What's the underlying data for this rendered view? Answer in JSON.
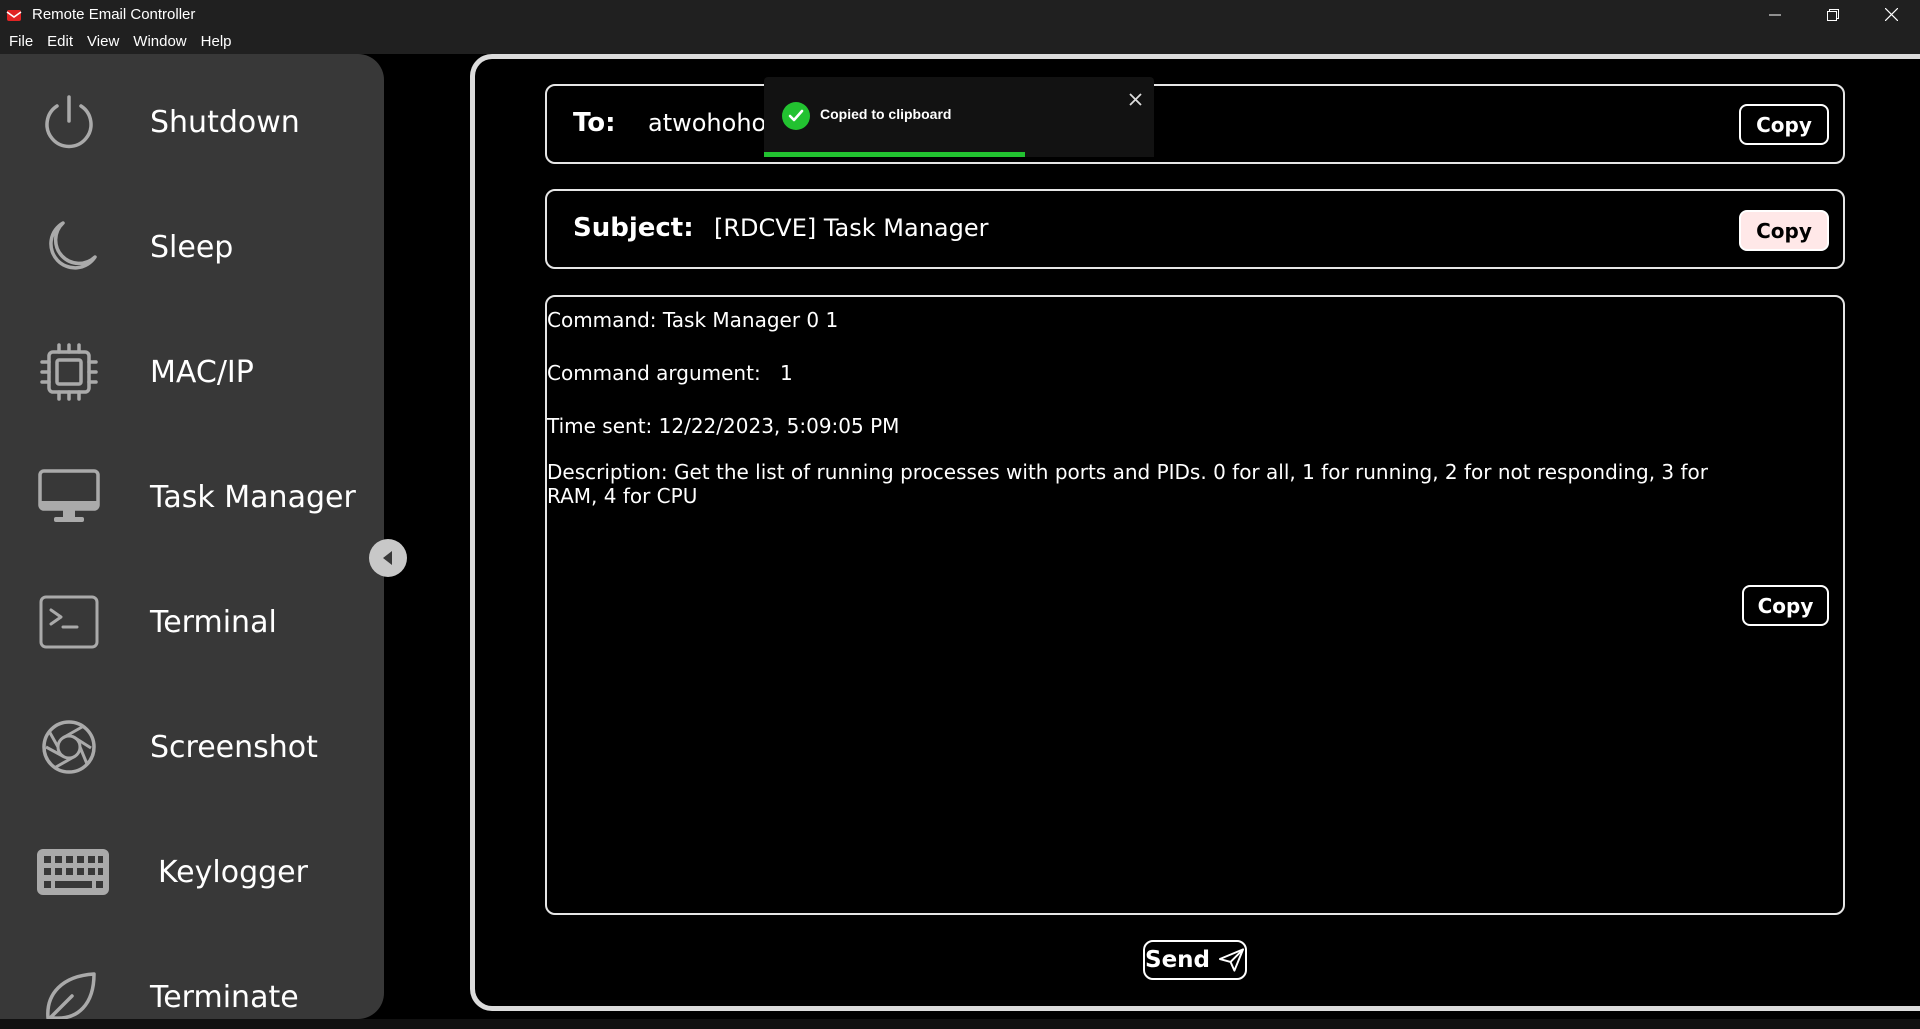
{
  "window": {
    "title": "Remote Email Controller"
  },
  "menu": [
    "File",
    "Edit",
    "View",
    "Window",
    "Help"
  ],
  "sidebar": {
    "items": [
      {
        "label": "Shutdown",
        "icon": "power-icon"
      },
      {
        "label": "Sleep",
        "icon": "moon-icon"
      },
      {
        "label": "MAC/IP",
        "icon": "chip-icon"
      },
      {
        "label": "Task Manager",
        "icon": "monitor-icon"
      },
      {
        "label": "Terminal",
        "icon": "terminal-icon"
      },
      {
        "label": "Screenshot",
        "icon": "aperture-icon"
      },
      {
        "label": "Keylogger",
        "icon": "keyboard-icon"
      },
      {
        "label": "Terminate",
        "icon": "leaf-icon"
      }
    ]
  },
  "email": {
    "to_label": "To:",
    "to_value": "atwohoho",
    "subject_label": "Subject:",
    "subject_value": "[RDCVE] Task Manager",
    "body": {
      "command": "Command: Task Manager 0 1",
      "argument_label": "Command argument:",
      "argument_value": "1",
      "time_sent": "Time sent: 12/22/2023, 5:09:05 PM",
      "description": "Description: Get the list of running processes with ports and PIDs. 0 for all, 1 for running, 2 for not responding, 3 for RAM, 4 for CPU"
    },
    "copy_label": "Copy",
    "send_label": "Send"
  },
  "toast": {
    "message": "Copied to clipboard",
    "progress": 0.67
  },
  "colors": {
    "sidebar_bg": "#383838",
    "accent_green": "#22c230",
    "copy_active_bg": "#ffe8e8"
  }
}
